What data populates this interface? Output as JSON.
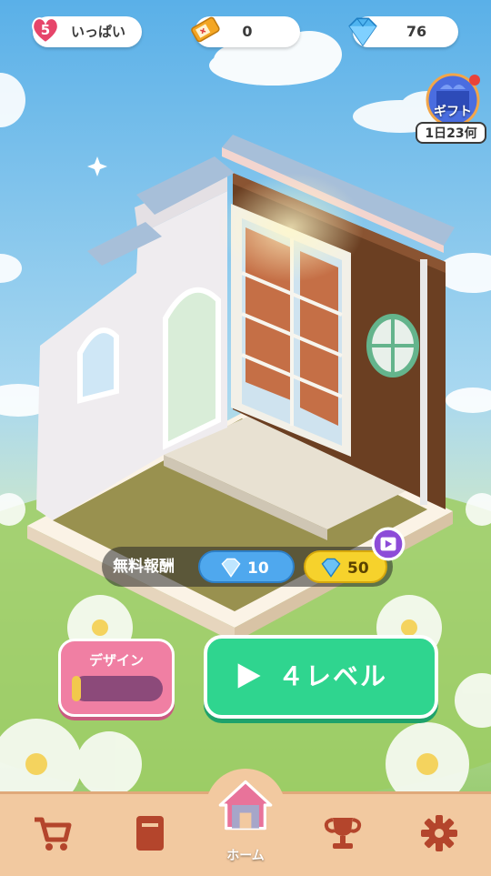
{
  "hud": {
    "lives_count": "5",
    "lives_status": "いっぱい",
    "tickets": "0",
    "gems": "76"
  },
  "gift": {
    "label": "ギフト",
    "timer": "1日23何"
  },
  "reward_bar": {
    "label": "無料報酬",
    "option1_gems": "10",
    "option2_gems": "50"
  },
  "design_button": {
    "label": "デザイン",
    "progress": 0.1
  },
  "play_button": {
    "label": "４レベル"
  },
  "nav": {
    "items": [
      {
        "icon": "shopping-cart-icon"
      },
      {
        "icon": "book-icon"
      },
      {
        "icon": "home-icon",
        "label": "ホーム"
      },
      {
        "icon": "trophy-icon"
      },
      {
        "icon": "gear-icon"
      }
    ]
  },
  "colors": {
    "play_green": "#2fd58f",
    "design_pink": "#f07fa3",
    "nav_tan": "#f2c9a0"
  }
}
